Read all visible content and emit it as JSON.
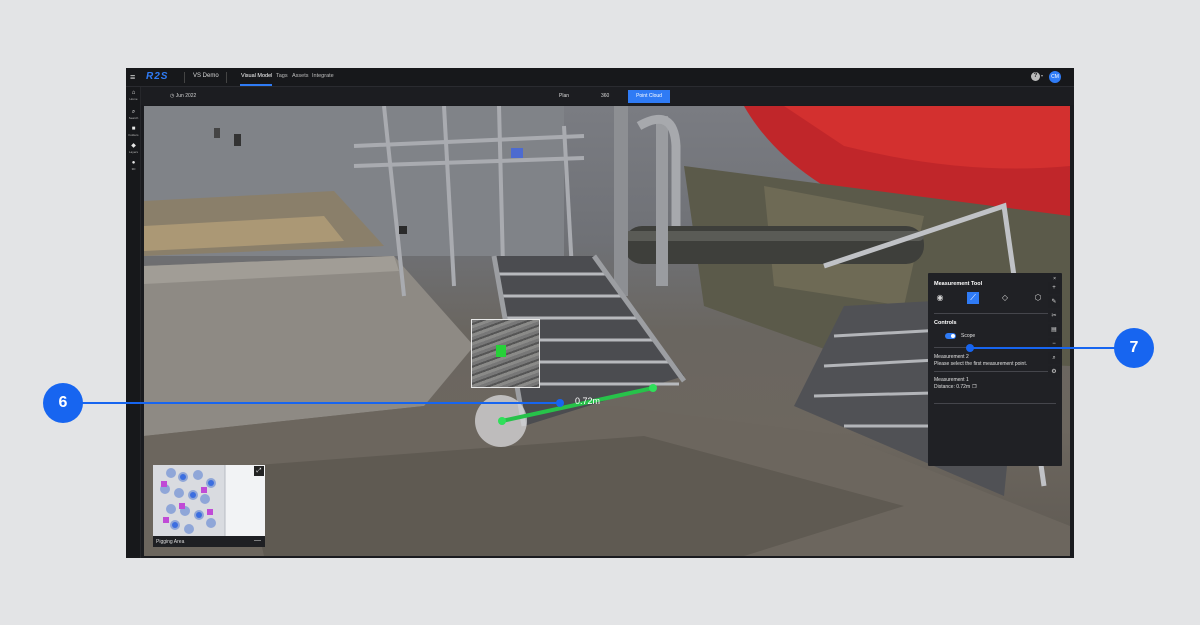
{
  "app": {
    "logo": "R2S",
    "project": "VS Demo",
    "menu_icon": "hamburger-icon",
    "tabs": [
      "Visual Model",
      "Tags",
      "Assets",
      "Integrate"
    ],
    "active_tab": "Visual Model",
    "help": "?",
    "help_caret": "▾",
    "avatar": "CM",
    "accent": "#2f7bf5"
  },
  "rail": {
    "items": [
      {
        "icon": "home-icon",
        "glyph": "⌂",
        "label": "Home"
      },
      {
        "icon": "search-icon",
        "glyph": "⌕",
        "label": "Search"
      },
      {
        "icon": "folder-icon",
        "glyph": "■",
        "label": "Folders"
      },
      {
        "icon": "layers-icon",
        "glyph": "◆",
        "label": "Layers"
      },
      {
        "icon": "3d-icon",
        "glyph": "●",
        "label": "3D"
      }
    ]
  },
  "subbar": {
    "date_icon": "clock-icon",
    "date": "◷ Jun 2022",
    "views": [
      "Plan",
      "360",
      "Point Cloud"
    ],
    "active_view": "Point Cloud"
  },
  "viewport": {
    "distance_label": "0.72m"
  },
  "minimap": {
    "label": "Pigging Area",
    "expand_glyph": "⤢",
    "minimize_glyph": "—"
  },
  "measurement_tool": {
    "title": "Measurement Tool",
    "close": "×",
    "tools": [
      {
        "icon": "point-icon",
        "glyph": "◉"
      },
      {
        "icon": "line-icon",
        "glyph": "⟋"
      },
      {
        "icon": "polygon-icon",
        "glyph": "◇"
      },
      {
        "icon": "cube-icon",
        "glyph": "⬡"
      }
    ],
    "controls_title": "Controls",
    "scope_label": "Scope",
    "scope_on": true,
    "measurement2_title": "Measurement 2",
    "measurement2_text": "Please select the first measurement point.",
    "measurement1_title": "Measurement 1",
    "measurement1_distance": "Distance: 0.72m",
    "copy_glyph": "❐"
  },
  "side_tools": [
    {
      "icon": "plus-icon",
      "glyph": "+"
    },
    {
      "icon": "pencil-icon",
      "glyph": "✎"
    },
    {
      "icon": "scissors-icon",
      "glyph": "✂"
    },
    {
      "icon": "layers-icon",
      "glyph": "▤"
    },
    {
      "icon": "minus-icon",
      "glyph": "−"
    },
    {
      "icon": "search-icon",
      "glyph": "⌕"
    },
    {
      "icon": "gear-icon",
      "glyph": "⚙"
    }
  ],
  "callouts": [
    "6",
    "7"
  ]
}
